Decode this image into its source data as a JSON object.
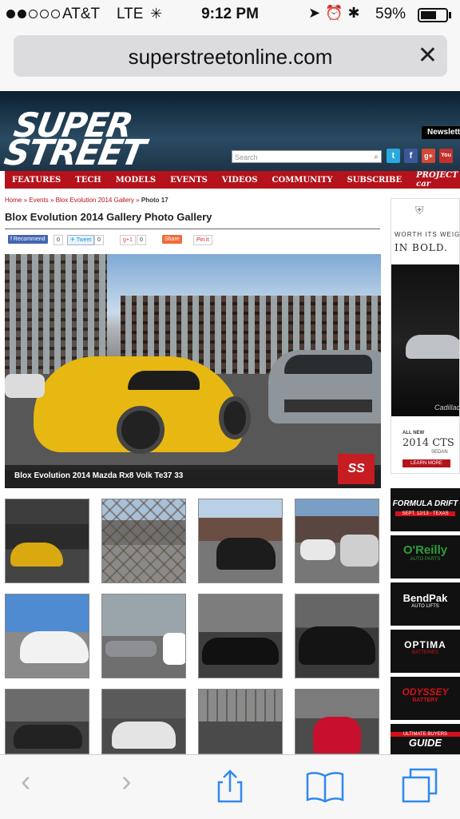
{
  "status_bar": {
    "carrier": "AT&T",
    "network": "LTE",
    "time": "9:12 PM",
    "battery": "59%",
    "signal_bars_filled": 2,
    "battery_level": 0.59
  },
  "browser": {
    "url": "superstreetonline.com"
  },
  "site": {
    "logo_line1": "SUPER",
    "logo_line2": "STREET",
    "newsletter": "Newslett",
    "search_placeholder": "Search",
    "social": [
      "t",
      "f",
      "g+",
      "You"
    ],
    "nav": [
      "FEATURES",
      "TECH",
      "MODELS",
      "EVENTS",
      "VIDEOS",
      "COMMUNITY",
      "SUBSCRIBE",
      "PROJECT car"
    ]
  },
  "breadcrumb": {
    "items": [
      "Home",
      "Events",
      "Blox Evolution 2014 Gallery"
    ],
    "current": "Photo 17",
    "sep": "»"
  },
  "page": {
    "title": "Blox Evolution 2014 Gallery Photo Gallery"
  },
  "share": {
    "recommend": "Recommend",
    "recommend_count": "0",
    "tweet": "Tweet",
    "tweet_count": "0",
    "gplus": "+1",
    "gplus_count": "0",
    "share": "Share",
    "pin": "Pin it"
  },
  "photo": {
    "caption": "Blox Evolution 2014 Mazda Rx8 Volk Te37 33",
    "logo": "SS"
  },
  "ad": {
    "brand": "Cadillac",
    "tagline1": "WORTH ITS WEIGH",
    "tagline2": "IN BOLD.",
    "all_new": "ALL NEW",
    "model": "2014 CTS",
    "sedan": "SEDAN",
    "learn": "LEARN MORE"
  },
  "sponsors": [
    {
      "name": "FORMULA DRIFT",
      "sub": "SEPT. 12/13 - TEXAS",
      "color": "#d1121b"
    },
    {
      "name": "O'Reilly",
      "sub": "AUTO PARTS",
      "color": "#2f9e3a"
    },
    {
      "name": "BendPak",
      "sub": "AUTO LIFTS",
      "color": "#ffffff"
    },
    {
      "name": "OPTIMA",
      "sub": "BATTERIES",
      "color": "#ffffff"
    },
    {
      "name": "ODYSSEY",
      "sub": "BATTERY",
      "color": "#d1121b"
    },
    {
      "name": "GUIDE",
      "sub": "ULTIMATE BUYERS",
      "color": "#ffffff"
    }
  ]
}
